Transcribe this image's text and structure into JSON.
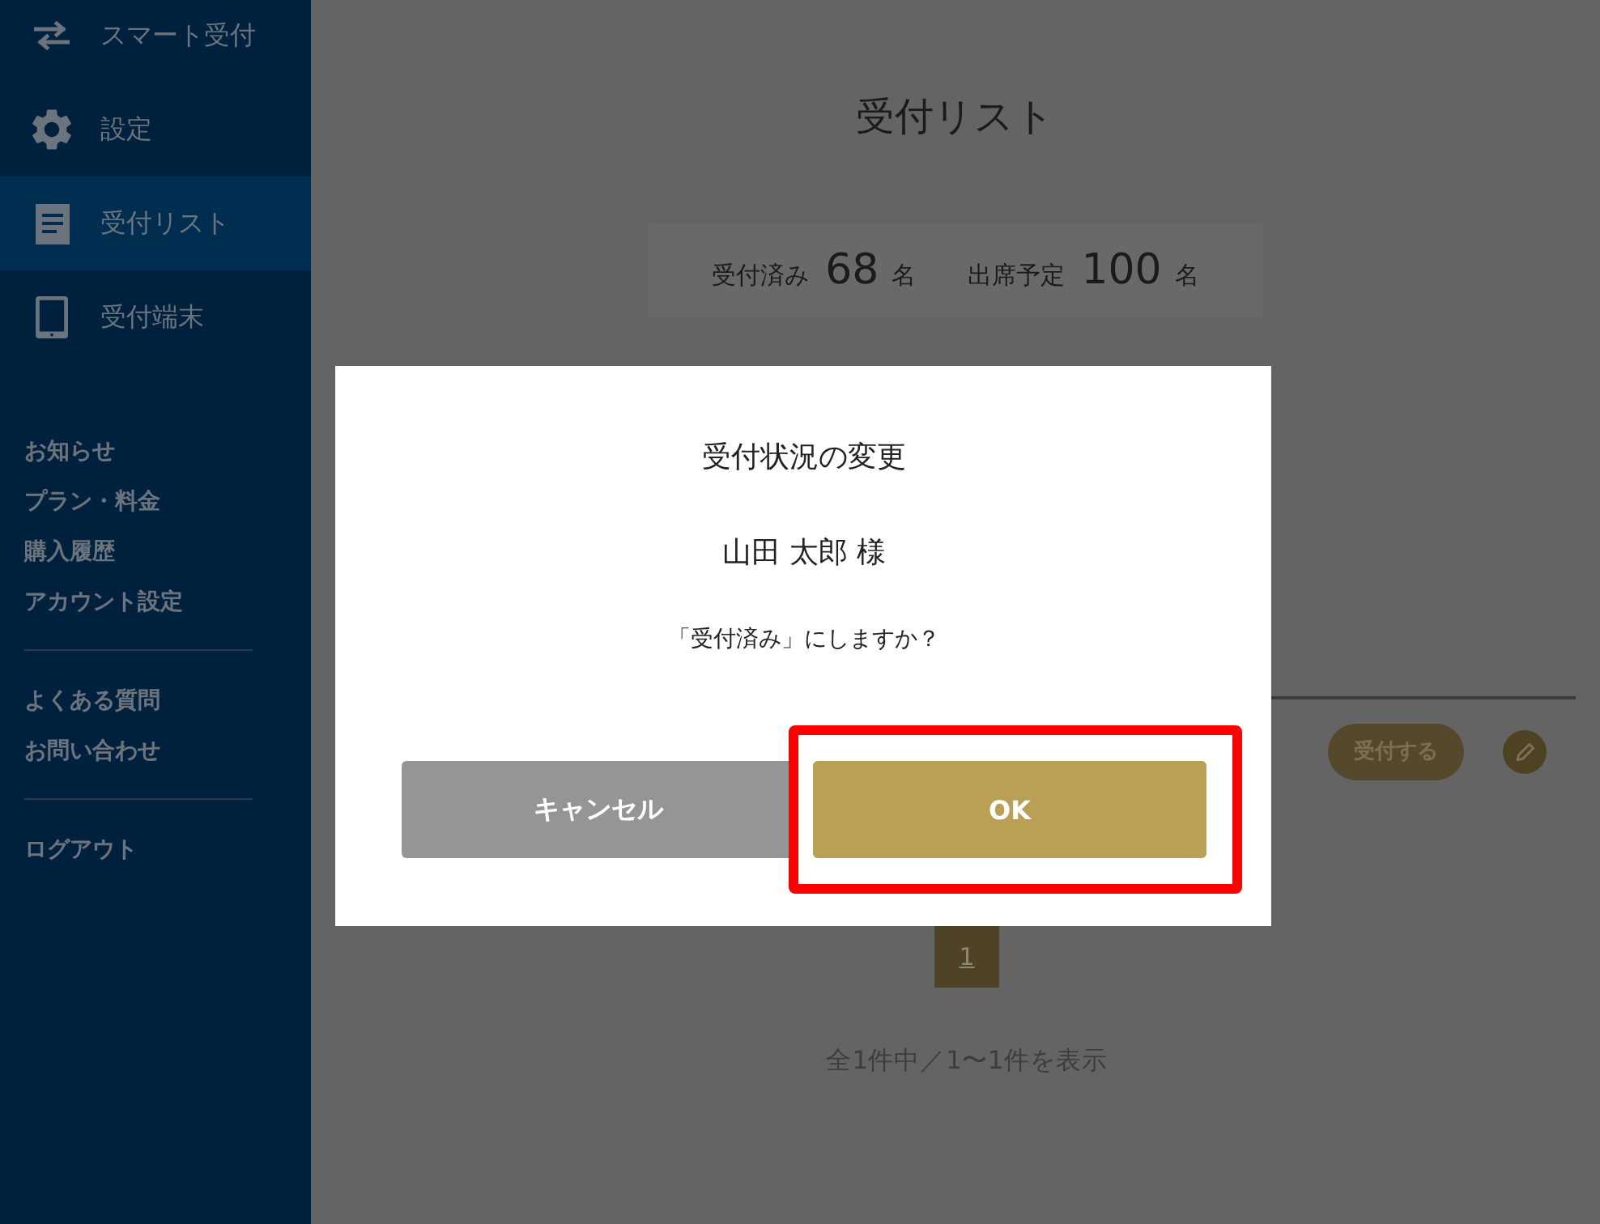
{
  "sidebar": {
    "nav": [
      {
        "label": "スマート受付",
        "selected": false
      },
      {
        "label": "設定",
        "selected": false
      },
      {
        "label": "受付リスト",
        "selected": true
      },
      {
        "label": "受付端末",
        "selected": false
      }
    ],
    "link_groups": [
      [
        "お知らせ",
        "プラン・料金",
        "購入履歴",
        "アカウント設定"
      ],
      [
        "よくある質問",
        "お問い合わせ"
      ],
      [
        "ログアウト"
      ]
    ]
  },
  "page": {
    "title": "受付リスト",
    "stats": [
      {
        "label": "受付済み",
        "value": "68",
        "unit": "名"
      },
      {
        "label": "出席予定",
        "value": "100",
        "unit": "名"
      }
    ]
  },
  "table": {
    "rows": [
      {
        "action": "受付する"
      }
    ]
  },
  "pagination": {
    "pages": [
      {
        "label": "1",
        "selected": true
      }
    ],
    "summary": "全1件中／1〜1件を表示"
  },
  "dialog": {
    "title": "受付状況の変更",
    "name": "山田 太郎 様",
    "message": "「受付済み」にしますか？",
    "buttons": [
      {
        "label": "キャンセル",
        "kind": "cancel",
        "highlighted": false
      },
      {
        "label": "OK",
        "kind": "confirm",
        "highlighted": true
      }
    ]
  }
}
